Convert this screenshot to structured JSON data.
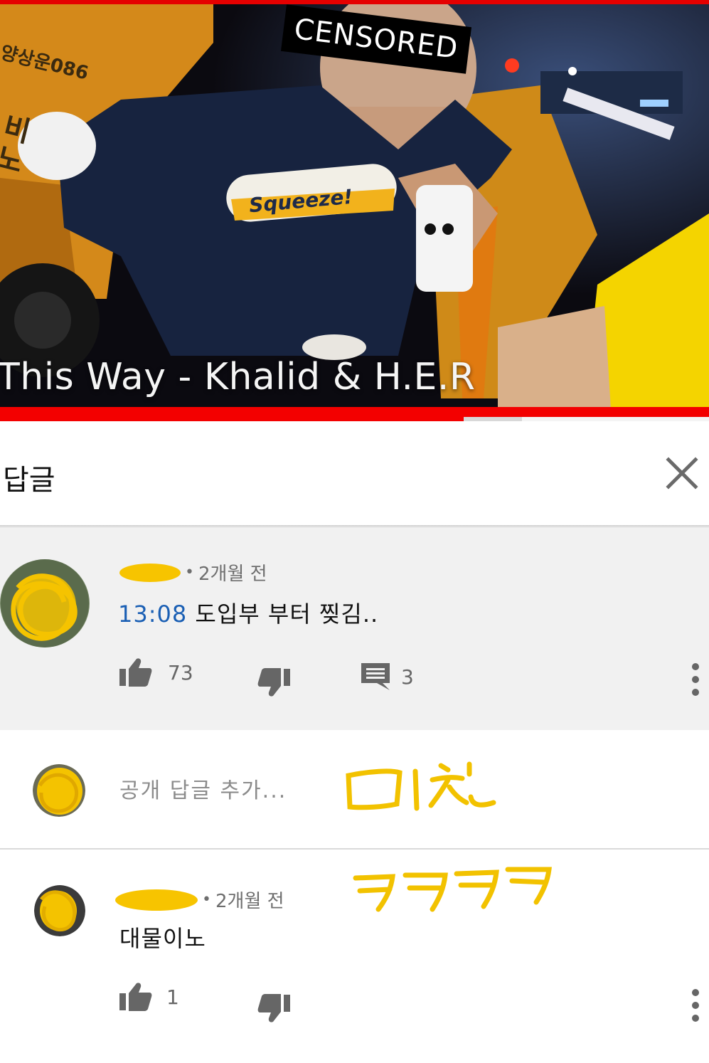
{
  "video": {
    "title_overlay": "This Way - Khalid & H.E.R",
    "censor_label": "CENSORED",
    "shirt_text": "Squeeze!",
    "taxi_text": "양상운086",
    "taxi_text2": "비\n노",
    "progress_fraction": 0.654,
    "buffer_fraction": 0.736,
    "colors": {
      "progress": "#f30000",
      "buffer": "#d8d8d8"
    }
  },
  "replies_panel": {
    "title": "답글",
    "close_icon": "close-icon"
  },
  "main_comment": {
    "author": "",
    "separator": "•",
    "time": "2개월 전",
    "timestamp": "13:08",
    "text": " 도입부 부터 찢김..",
    "likes": "73",
    "replies": "3",
    "icons": [
      "thumbs-up-icon",
      "thumbs-down-icon",
      "comment-icon",
      "more-vert-icon"
    ]
  },
  "add_reply": {
    "placeholder": "공개 답글 추가..."
  },
  "reply": {
    "author": "",
    "separator": "•",
    "time": "2개월 전",
    "text": "대물이노",
    "likes": "1"
  },
  "annotations": {
    "handwritten_1": "미친",
    "handwritten_2": "ㅋㅋㅋㅋ",
    "marker_color": "#f2c200"
  }
}
